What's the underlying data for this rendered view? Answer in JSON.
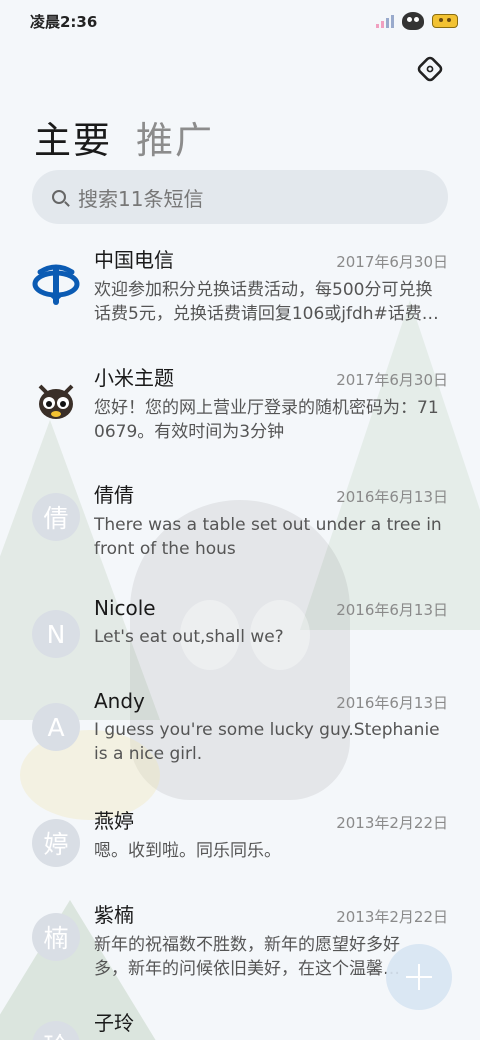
{
  "status_bar": {
    "time": "凌晨2:36"
  },
  "tabs": [
    {
      "label": "主要",
      "active": true
    },
    {
      "label": "推广",
      "active": false
    }
  ],
  "search": {
    "placeholder": "搜索11条短信"
  },
  "conversations": [
    {
      "name": "中国电信",
      "date": "2017年6月30日",
      "preview": "欢迎参加积分兑换话费活动，每500分可兑换话费5元，兑换话费请回复106或jfdh#话费…",
      "avatar": "china-telecom-logo"
    },
    {
      "name": "小米主题",
      "date": "2017年6月30日",
      "preview": "您好！您的网上营业厅登录的随机密码为：710679。有效时间为3分钟",
      "avatar": "mi-theme-mascot"
    },
    {
      "name": "倩倩",
      "date": "2016年6月13日",
      "preview": "There was a table set out under a tree in front of the hous",
      "avatar_letter": "倩"
    },
    {
      "name": "Nicole",
      "date": "2016年6月13日",
      "preview": "Let's eat out,shall we?",
      "avatar_letter": "N"
    },
    {
      "name": "Andy",
      "date": "2016年6月13日",
      "preview": "I guess you're some lucky guy.Stephanie is a nice girl.",
      "avatar_letter": "A"
    },
    {
      "name": "燕婷",
      "date": "2013年2月22日",
      "preview": "嗯。收到啦。同乐同乐。",
      "avatar_letter": "婷"
    },
    {
      "name": "紫楠",
      "date": "2013年2月22日",
      "preview": "新年的祝福数不胜数，新年的愿望好多好多，新年的问候依旧美好，在这个温馨的时刻",
      "avatar_letter": "楠"
    },
    {
      "name": "子玲",
      "date": "",
      "preview": "",
      "avatar_letter": "玲"
    }
  ],
  "icons": {
    "settings": "settings-icon",
    "fab": "plus-icon",
    "search": "search-icon"
  },
  "colors": {
    "telecom_blue": "#0b5bb3",
    "avatar_bg": "#d9dee5"
  }
}
